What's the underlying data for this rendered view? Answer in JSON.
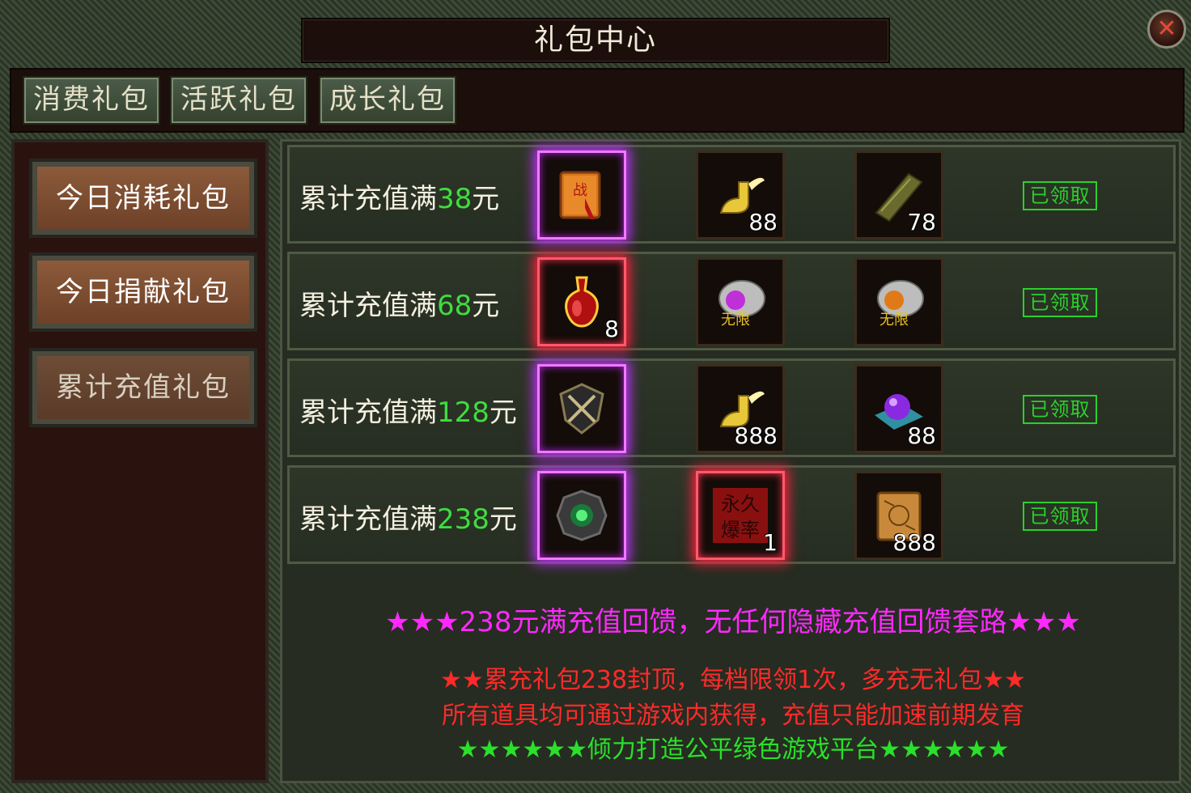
{
  "window": {
    "title": "礼包中心",
    "close_icon": "close-icon"
  },
  "tabs": [
    {
      "label": "消费礼包"
    },
    {
      "label": "活跃礼包"
    },
    {
      "label": "成长礼包"
    }
  ],
  "sidebar": {
    "items": [
      {
        "label": "今日消耗礼包",
        "state": "normal"
      },
      {
        "label": "今日捐献礼包",
        "state": "normal"
      },
      {
        "label": "累计充值礼包",
        "state": "selected"
      }
    ]
  },
  "tiers": [
    {
      "prefix": "累计充值满",
      "amount": "38",
      "unit": "元",
      "rewards": [
        {
          "icon": "war-book-icon",
          "count": "",
          "frame": "purple"
        },
        {
          "icon": "winged-boot-icon",
          "count": "88",
          "frame": "none"
        },
        {
          "icon": "scroll-icon",
          "count": "78",
          "frame": "none"
        }
      ],
      "status": "已领取"
    },
    {
      "prefix": "累计充值满",
      "amount": "68",
      "unit": "元",
      "rewards": [
        {
          "icon": "red-potion-icon",
          "count": "8",
          "frame": "red"
        },
        {
          "icon": "unlimited-purple-stone-icon",
          "count": "",
          "frame": "none"
        },
        {
          "icon": "unlimited-orange-stone-icon",
          "count": "",
          "frame": "none"
        }
      ],
      "status": "已领取"
    },
    {
      "prefix": "累计充值满",
      "amount": "128",
      "unit": "元",
      "rewards": [
        {
          "icon": "shield-emblem-icon",
          "count": "",
          "frame": "purple"
        },
        {
          "icon": "winged-boot-icon",
          "count": "888",
          "frame": "none"
        },
        {
          "icon": "purple-orb-icon",
          "count": "88",
          "frame": "none"
        }
      ],
      "status": "已领取"
    },
    {
      "prefix": "累计充值满",
      "amount": "238",
      "unit": "元",
      "rewards": [
        {
          "icon": "green-gem-medal-icon",
          "count": "",
          "frame": "purple"
        },
        {
          "icon": "permanent-drop-rate-icon",
          "count": "1",
          "frame": "red"
        },
        {
          "icon": "treasure-map-icon",
          "count": "888",
          "frame": "none"
        }
      ],
      "status": "已领取"
    }
  ],
  "notes": {
    "line1": "★★★238元满充值回馈，无任何隐藏充值回馈套路★★★",
    "line2": "★★累充礼包238封顶，每档限领1次，多充无礼包★★",
    "line3": "所有道具均可通过游戏内获得，充值只能加速前期发育",
    "line4": "★★★★★★倾力打造公平绿色游戏平台★★★★★★"
  },
  "item_text": {
    "permanent_drop_top": "永久",
    "permanent_drop_bottom": "爆率",
    "unlimited": "无限",
    "war_book": "战"
  },
  "colors": {
    "amount": "#3fdc3f",
    "claimed": "#2bd02b",
    "note_magenta": "#ff28ff",
    "note_red": "#ff2a2a",
    "note_green": "#2ae02a",
    "purple_frame": "#c330ff",
    "red_frame": "#ff2040"
  }
}
